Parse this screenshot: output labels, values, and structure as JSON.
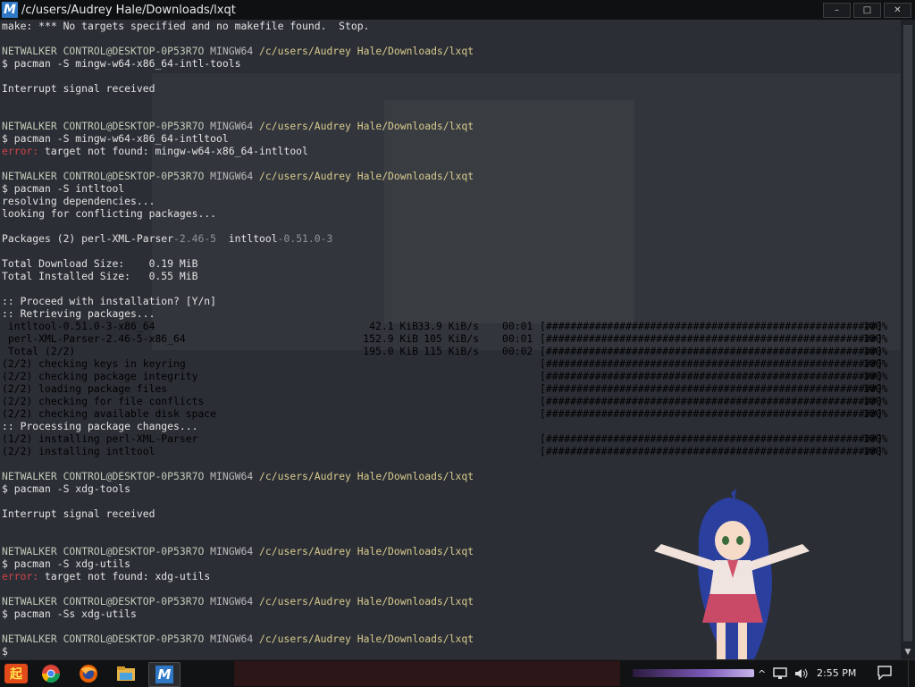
{
  "window": {
    "title": "/c/users/Audrey Hale/Downloads/lxqt",
    "app_icon_letter": "M",
    "minimize": "–",
    "maximize": "□",
    "close": "✕"
  },
  "colors": {
    "terminal_bg": "#2b2f35",
    "prompt_user": "#c2c8b8",
    "prompt_path": "#d8c98d",
    "error": "#d2424b",
    "text": "#e2e2e2"
  },
  "prompt": {
    "user": "NETWALKER CONTROL@DESKTOP-0P53R7O",
    "shell": "MINGW64",
    "path": "/c/users/Audrey Hale/Downloads/lxqt"
  },
  "terminal": {
    "l_make": "make: *** No targets specified and no makefile found.  Stop.",
    "cmd1": "$ pacman -S mingw-w64-x86_64-intl-tools",
    "interrupt1": "Interrupt signal received",
    "cmd2": "$ pacman -S mingw-w64-x86_64-intltool",
    "err2_label": "error:",
    "err2_text": " target not found: mingw-w64-x86_64-intltool",
    "cmd3": "$ pacman -S intltool",
    "resolving": "resolving dependencies...",
    "looking": "looking for conflicting packages...",
    "packages_prefix": "Packages (2) perl-XML-Parser",
    "packages_v1": "-2.46-5",
    "packages_mid": "  intltool",
    "packages_v2": "-0.51.0-3",
    "total_dl": "Total Download Size:    0.19 MiB",
    "total_inst": "Total Installed Size:   0.55 MiB",
    "proceed": ":: Proceed with installation? [Y/n]",
    "retrieving": ":: Retrieving packages...",
    "processing": ":: Processing package changes...",
    "cmd4": "$ pacman -S xdg-tools",
    "interrupt2": "Interrupt signal received",
    "cmd5": "$ pacman -S xdg-utils",
    "err5_label": "error:",
    "err5_text": " target not found: xdg-utils",
    "cmd6": "$ pacman -Ss xdg-utils",
    "final_prompt": "$"
  },
  "downloads": [
    {
      "name": " intltool-0.51.0-3-x86_64",
      "size": "42.1 KiB",
      "rate": " 33.9 KiB/s",
      "time": "00:01",
      "bar": "[######################################################]",
      "pct": "100%"
    },
    {
      "name": " perl-XML-Parser-2.46-5-x86_64",
      "size": "152.9 KiB",
      "rate": "  105 KiB/s",
      "time": "00:01",
      "bar": "[######################################################]",
      "pct": "100%"
    },
    {
      "name": " Total (2/2)",
      "size": "195.0 KiB",
      "rate": "  115 KiB/s",
      "time": "00:02",
      "bar": "[######################################################]",
      "pct": "100%"
    }
  ],
  "steps": [
    {
      "label": "(2/2) checking keys in keyring",
      "bar": "[######################################################]",
      "pct": "100%"
    },
    {
      "label": "(2/2) checking package integrity",
      "bar": "[######################################################]",
      "pct": "100%"
    },
    {
      "label": "(2/2) loading package files",
      "bar": "[######################################################]",
      "pct": "100%"
    },
    {
      "label": "(2/2) checking for file conflicts",
      "bar": "[######################################################]",
      "pct": "100%"
    },
    {
      "label": "(2/2) checking available disk space",
      "bar": "[######################################################]",
      "pct": "100%"
    }
  ],
  "installs": [
    {
      "label": "(1/2) installing perl-XML-Parser",
      "bar": "[######################################################]",
      "pct": "100%"
    },
    {
      "label": "(2/2) installing intltool",
      "bar": "[######################################################]",
      "pct": "100%"
    }
  ],
  "taskbar": {
    "clock": "2:55 PM",
    "msys_letter": "M",
    "items": [
      "start-icon",
      "chrome-icon",
      "firefox-icon",
      "file-explorer-icon",
      "msys2-icon"
    ]
  }
}
